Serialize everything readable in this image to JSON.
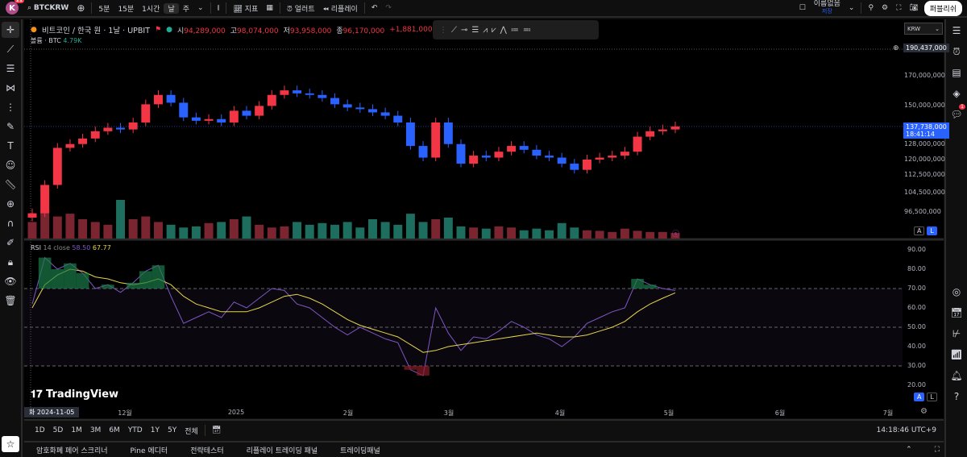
{
  "topbar": {
    "avatar_letter": "K",
    "avatar_badge": "11",
    "symbol": "BTCKRW",
    "intervals": [
      "5분",
      "15분",
      "1시간",
      "날",
      "주"
    ],
    "indicators": "지표",
    "alert": "얼러트",
    "replay": "리플레이",
    "layout_name": "이름없음",
    "layout_status": "저장",
    "publish": "퍼블리쉬"
  },
  "legend": {
    "title": "비트코인 / 한국 원 · 1날 · UPBIT",
    "o_label": "시",
    "o": "94,289,000",
    "h_label": "고",
    "h": "98,074,000",
    "l_label": "저",
    "l": "93,958,000",
    "c_label": "종",
    "c": "96,170,000",
    "change": "+1,881,000 (+1.99%)",
    "volume_label": "볼륨 · BTC",
    "volume": "4.79K"
  },
  "currency": "KRW",
  "price_axis": {
    "top_label": "190,437,000",
    "ticks": [
      "170,000,000",
      "150,000,000",
      "128,000,000",
      "120,000,000",
      "112,500,000",
      "104,500,000",
      "96,500,000"
    ],
    "last_price": "137,738,000",
    "countdown": "18:41:14"
  },
  "rsi": {
    "label": "RSI",
    "params": "14 close",
    "value": "58.50",
    "ma": "67.77",
    "ticks": [
      "90.00",
      "80.00",
      "70.00",
      "60.00",
      "50.00",
      "40.00",
      "30.00",
      "20.00"
    ]
  },
  "time_axis": {
    "cursor": "화 2024-11-05",
    "labels": [
      "12월",
      "2025",
      "2월",
      "3월",
      "4월",
      "5월",
      "6월",
      "7월"
    ]
  },
  "range": [
    "1D",
    "5D",
    "1M",
    "3M",
    "6M",
    "YTD",
    "1Y",
    "5Y",
    "전체"
  ],
  "clock": "14:18:46 UTC+9",
  "bottom_tabs": [
    "암호화폐 페어 스크리너",
    "Pine 에디터",
    "전략테스터",
    "리플레이 트레이딩 패널",
    "트레이딩패널"
  ],
  "watermark": "TradingView",
  "scale_buttons": {
    "a": "A",
    "l": "L"
  },
  "colors": {
    "up": "#f23645",
    "down": "#2962ff",
    "rsi": "#7e57c2",
    "rsi_ma": "#e6d64a"
  },
  "chart_data": {
    "type": "candlestick",
    "start": "2024-11-05",
    "step_days": 3,
    "closes": [
      96,
      108,
      126,
      128,
      131,
      135,
      137,
      136,
      140,
      151,
      157,
      152,
      143,
      141,
      142,
      140,
      147,
      144,
      150,
      157,
      160,
      158,
      157,
      155,
      151,
      149,
      148,
      146,
      144,
      140,
      127,
      121,
      140,
      128,
      118,
      122,
      121,
      124,
      127,
      125,
      122,
      121,
      118,
      115,
      120,
      121,
      122,
      124,
      132,
      135,
      136,
      137.7
    ],
    "volumes": [
      30,
      55,
      40,
      45,
      35,
      30,
      25,
      70,
      35,
      40,
      30,
      25,
      20,
      22,
      28,
      30,
      35,
      40,
      25,
      20,
      22,
      30,
      25,
      28,
      25,
      30,
      20,
      35,
      30,
      25,
      45,
      30,
      35,
      38,
      22,
      20,
      18,
      22,
      20,
      15,
      18,
      15,
      28,
      20,
      15,
      14,
      12,
      18,
      14,
      12,
      12,
      10
    ],
    "rsi": [
      62,
      86,
      80,
      83,
      78,
      70,
      72,
      68,
      73,
      79,
      82,
      66,
      52,
      55,
      58,
      55,
      63,
      60,
      65,
      70,
      69,
      62,
      60,
      55,
      50,
      46,
      50,
      47,
      44,
      42,
      28,
      25,
      60,
      47,
      38,
      45,
      44,
      48,
      53,
      50,
      46,
      44,
      40,
      45,
      52,
      55,
      58,
      60,
      75,
      72,
      70,
      69
    ],
    "rsi_ma": [
      60,
      72,
      77,
      80,
      79,
      76,
      75,
      73,
      72,
      73,
      75,
      72,
      66,
      62,
      60,
      58,
      58,
      58,
      60,
      63,
      66,
      67,
      65,
      62,
      58,
      54,
      51,
      49,
      47,
      45,
      41,
      37,
      38,
      40,
      41,
      42,
      43,
      44,
      45,
      46,
      47,
      46,
      45,
      45,
      46,
      48,
      50,
      53,
      58,
      62,
      65,
      67.8
    ],
    "rsi_levels": [
      70,
      50,
      30
    ]
  }
}
